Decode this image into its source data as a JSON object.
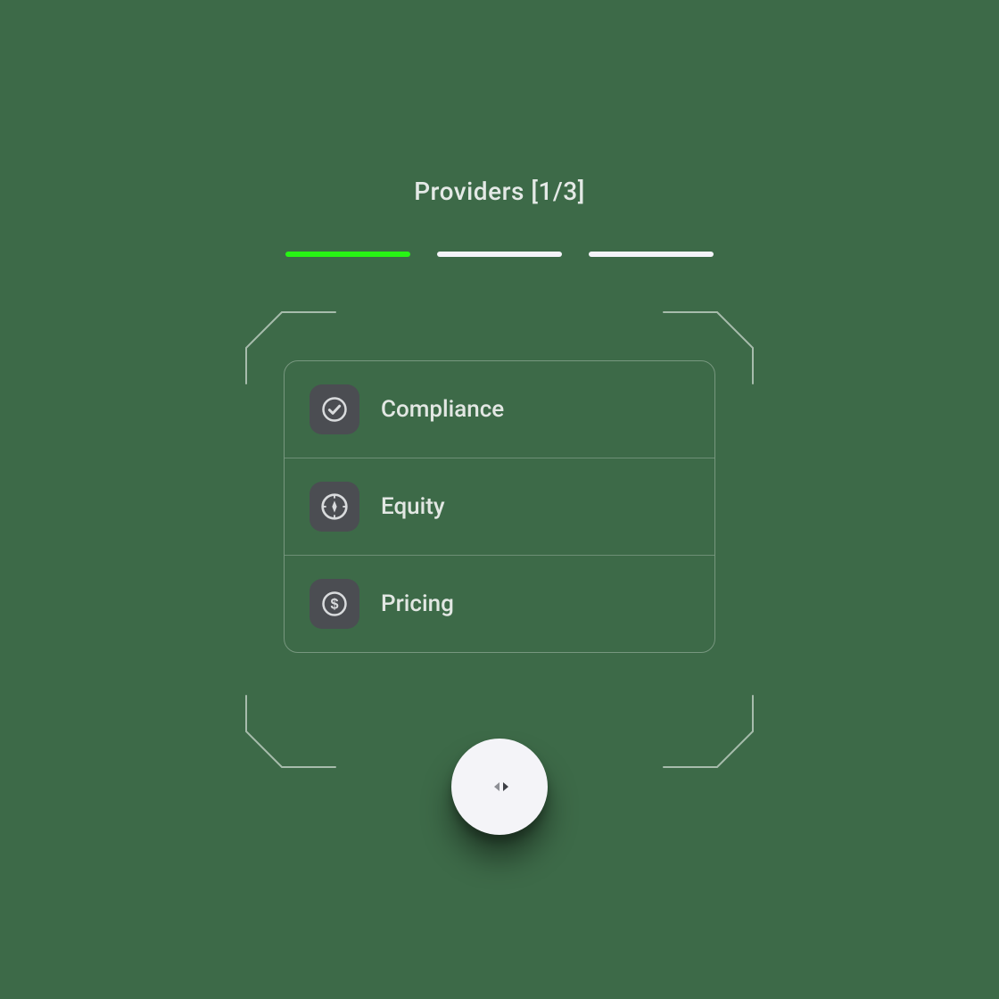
{
  "header": {
    "title": "Providers [1/3]"
  },
  "progress": {
    "current": 1,
    "total": 3
  },
  "card": {
    "items": [
      {
        "icon": "check-icon",
        "label": "Compliance"
      },
      {
        "icon": "compass-icon",
        "label": "Equity"
      },
      {
        "icon": "dollar-icon",
        "label": "Pricing"
      }
    ]
  }
}
